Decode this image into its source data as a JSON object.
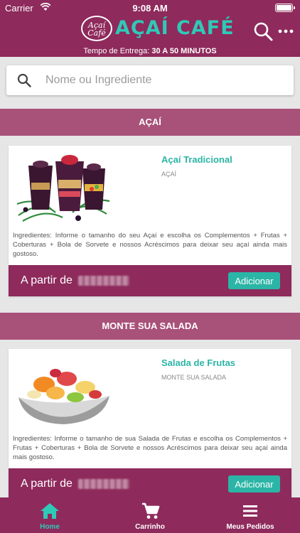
{
  "status_bar": {
    "carrier": "Carrier",
    "time": "9:08 AM",
    "battery_level": 1.0
  },
  "header": {
    "logo_badge_text": "Açaí Café",
    "logo_title": "AÇAÍ CAFÉ",
    "delivery_label": "Tempo de Entrega:",
    "delivery_value": "30 A 50 MINUTOS",
    "icons": [
      "search-icon",
      "more-icon"
    ]
  },
  "search": {
    "placeholder": "Nome ou Ingrediente",
    "value": ""
  },
  "sections": [
    {
      "title": "AÇAÍ",
      "product": {
        "name": "Açaí Tradicional",
        "category": "AÇAÍ",
        "description": "Ingredientes: Informe o tamanho do seu Açaí e escolha os Complementos + Frutas + Coberturas + Bola de Sorvete e nossos Acréscimos para deixar seu açaí ainda mais gostoso.",
        "price_prefix": "A partir de",
        "add_label": "Adicionar"
      }
    },
    {
      "title": "MONTE SUA SALADA",
      "product": {
        "name": "Salada de Frutas",
        "category": "MONTE SUA SALADA",
        "description": "Ingredientes: Informe o tamanho de sua Salada de Frutas e escolha os Complementos + Frutas + Coberturas + Bola de Sorvete e nossos Acréscimos para deixar seu açaí ainda mais gostoso.",
        "price_prefix": "A partir de",
        "add_label": "Adicionar"
      }
    }
  ],
  "tabs": [
    {
      "label": "Home",
      "icon": "home-icon",
      "active": true
    },
    {
      "label": "Carrinho",
      "icon": "cart-icon",
      "active": false
    },
    {
      "label": "Meus Pedidos",
      "icon": "list-icon",
      "active": false
    }
  ],
  "colors": {
    "brand": "#8e2a5c",
    "section": "#a85179",
    "accent": "#2bb5a6",
    "background": "#e6e6e6"
  }
}
